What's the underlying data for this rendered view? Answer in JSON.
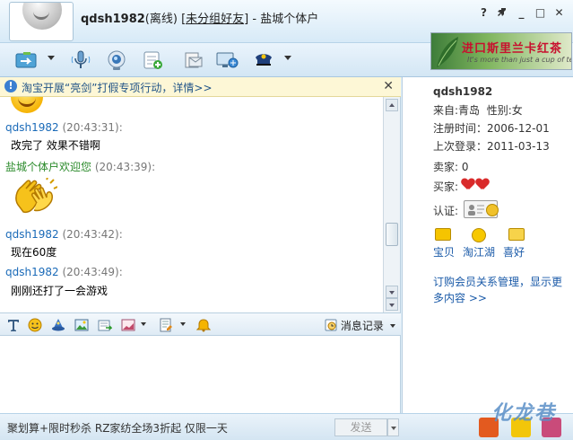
{
  "title": {
    "nickname": "qdsh1982",
    "status": "(离线)",
    "group": "[未分组好友]",
    "separator": " - ",
    "shop": "盐城个体户",
    "window_buttons": [
      "?",
      "✕",
      "_",
      "□",
      "✕"
    ]
  },
  "ad_banner": {
    "big": "进口斯里兰卡红茶",
    "small": "It's more than just a cup of tea"
  },
  "notice": {
    "text": "淘宝开展“亮剑”打假专项行动，详情>>",
    "close": "✕"
  },
  "chat": {
    "messages": [
      {
        "sender": "qdsh1982",
        "time": "(20:43:31):",
        "text": "改完了 效果不错啊"
      },
      {
        "sender": "盐城个体户欢迎您",
        "time": "(20:43:39):",
        "text": ""
      },
      {
        "sender": "qdsh1982",
        "time": "(20:43:42):",
        "text": "现在60度"
      },
      {
        "sender": "qdsh1982",
        "time": "(20:43:49):",
        "text": "刚刚还打了一会游戏"
      }
    ]
  },
  "format_bar": {
    "history": "消息记录"
  },
  "bottom": {
    "promo": "聚划算+限时秒杀 RZ家纺全场3折起 仅限一天",
    "send": "发送",
    "watermark": "化龙巷"
  },
  "profile": {
    "name": "qdsh1982",
    "from_label": "来自:",
    "from_value": "青岛",
    "gender_label": "性别:",
    "gender_value": "女",
    "register_label": "注册时间：",
    "register_value": "2006-12-01",
    "last_login_label": "上次登录：",
    "last_login_value": "2011-03-13",
    "seller_label": "卖家:",
    "seller_value": "0",
    "buyer_label": "买家:",
    "verify_label": "认证:",
    "links": [
      "宝贝",
      "淘江湖",
      "喜好"
    ],
    "order_link": "订购会员关系管理，显示更多内容 >>"
  },
  "colors": {
    "accent": "#1a6ab8",
    "window_bg": "#dfeef8"
  }
}
